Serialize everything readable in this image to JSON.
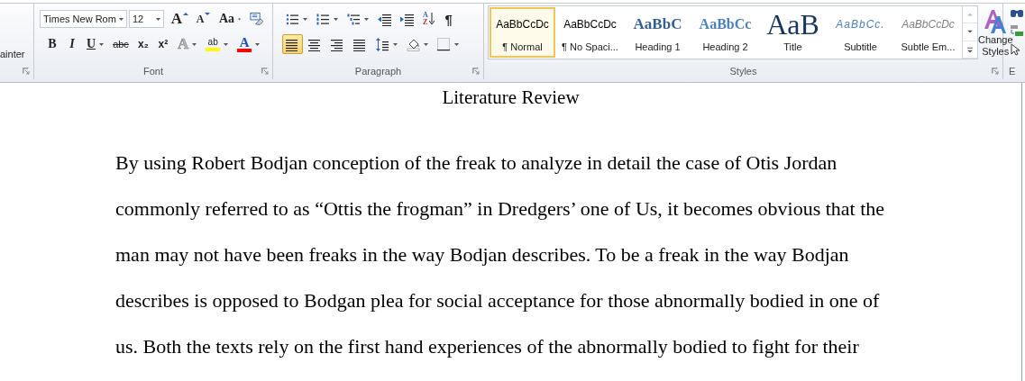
{
  "ribbon": {
    "clipboard": {
      "cut_label": "ainter"
    },
    "font": {
      "label": "Font",
      "font_name": "Times New Rom",
      "font_size": "12",
      "row1": [
        {
          "kind": "grow",
          "glyph": "A",
          "dropdown": false
        },
        {
          "kind": "shrink",
          "glyph": "A",
          "dropdown": false
        },
        {
          "kind": "case",
          "glyph": "Aa",
          "dropdown": true
        },
        {
          "kind": "clear",
          "dropdown": false
        }
      ],
      "row2": [
        {
          "kind": "bold",
          "glyph": "B",
          "dropdown": false
        },
        {
          "kind": "italic",
          "glyph": "I",
          "dropdown": false
        },
        {
          "kind": "underline",
          "glyph": "U",
          "dropdown": true
        },
        {
          "kind": "strike",
          "glyph": "abc",
          "dropdown": false
        },
        {
          "kind": "sub",
          "glyph": "x₂",
          "dropdown": false
        },
        {
          "kind": "super",
          "glyph": "x²",
          "dropdown": false
        },
        {
          "kind": "effects",
          "glyph": "A",
          "dropdown": true,
          "disabled": true
        },
        {
          "kind": "highlight",
          "glyph": "ab",
          "dropdown": true,
          "color": "#ffff00"
        },
        {
          "kind": "color",
          "glyph": "A",
          "dropdown": true,
          "color": "#ff0000"
        }
      ]
    },
    "paragraph": {
      "label": "Paragraph",
      "row1": [
        {
          "kind": "bullets",
          "dropdown": true
        },
        {
          "kind": "numbering",
          "dropdown": true
        },
        {
          "kind": "multilevel",
          "dropdown": true
        },
        {
          "kind": "outdent",
          "dropdown": false
        },
        {
          "kind": "indent",
          "dropdown": false
        },
        {
          "kind": "sort",
          "glyph": "AZ",
          "dropdown": false
        },
        {
          "kind": "marks",
          "glyph": "¶",
          "dropdown": false
        }
      ],
      "row2": [
        {
          "kind": "left",
          "dropdown": false,
          "selected": true
        },
        {
          "kind": "center",
          "dropdown": false,
          "selected": false
        },
        {
          "kind": "right",
          "dropdown": false,
          "selected": false
        },
        {
          "kind": "justify",
          "dropdown": false,
          "selected": false
        },
        {
          "kind": "spacing",
          "dropdown": true
        },
        {
          "kind": "shading",
          "dropdown": true
        },
        {
          "kind": "borders",
          "dropdown": true
        }
      ]
    },
    "styles": {
      "label": "Styles",
      "items": [
        {
          "kind": "normal",
          "sample": "AaBbCcDc",
          "label": "¶ Normal",
          "selected": true
        },
        {
          "kind": "nospacing",
          "sample": "AaBbCcDc",
          "label": "¶ No Spaci...",
          "selected": false
        },
        {
          "kind": "heading1",
          "sample": "AaBbC",
          "label": "Heading 1",
          "selected": false
        },
        {
          "kind": "heading2",
          "sample": "AaBbCc",
          "label": "Heading 2",
          "selected": false
        },
        {
          "kind": "title",
          "sample": "AaB",
          "label": "Title",
          "selected": false
        },
        {
          "kind": "subtitle",
          "sample": "AaBbCc.",
          "label": "Subtitle",
          "selected": false
        },
        {
          "kind": "emphasis",
          "sample": "AaBbCcDc",
          "label": "Subtle Em...",
          "selected": false
        }
      ],
      "change_styles": "Change Styles"
    },
    "editing": {
      "cut_label": "E"
    }
  },
  "document": {
    "title": "Literature Review",
    "lines": [
      "By using Robert Bodjan conception of the freak to analyze in detail the case of Otis Jordan",
      "commonly referred to as “Ottis the frogman” in Dredgers’ one of Us, it becomes obvious that the",
      "man may not have been freaks in the way Bodjan describes. To be a freak in the way Bodjan",
      "describes is opposed to Bodgan plea for social acceptance for those abnormally bodied in one of",
      "us. Both the texts rely on the first hand experiences of the abnormally bodied to fight for their"
    ]
  }
}
